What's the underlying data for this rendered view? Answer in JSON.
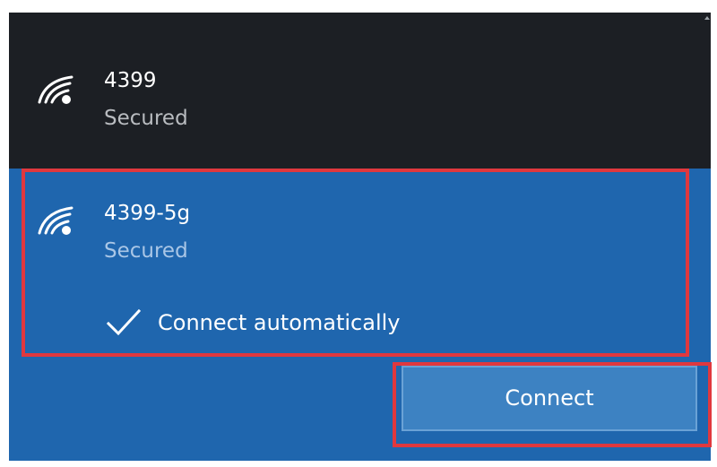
{
  "networks": [
    {
      "name": "4399",
      "status": "Secured",
      "icon": "wifi-signal-icon"
    },
    {
      "name": "4399-5g",
      "status": "Secured",
      "icon": "wifi-signal-icon",
      "selected": true
    }
  ],
  "connect_automatically": {
    "label": "Connect automatically",
    "checked": true
  },
  "connect_button": {
    "label": "Connect"
  },
  "colors": {
    "dark_row": "#1c1f24",
    "selected_blue": "#1f66ae",
    "button_blue": "#3d82c2",
    "highlight_red": "#e0383e"
  }
}
